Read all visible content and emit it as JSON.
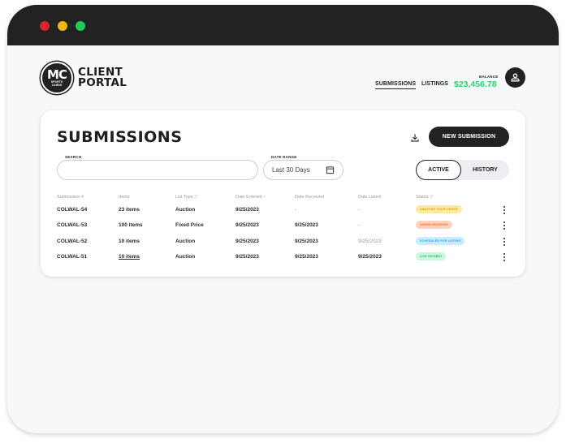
{
  "window": {
    "controls": [
      "close",
      "minimize",
      "maximize"
    ]
  },
  "brand": {
    "logo_initials": "MC",
    "logo_sub_1": "SPORTS",
    "logo_sub_2": "CARDS",
    "line1": "CLIENT",
    "line2": "PORTAL"
  },
  "nav": {
    "submissions": "SUBMISSIONS",
    "listings": "LISTINGS",
    "active": "SUBMISSIONS"
  },
  "balance": {
    "label": "BALANCE",
    "value": "$23,456.78",
    "color": "#2bd46a"
  },
  "page": {
    "title": "SUBMISSIONS",
    "new_submission_label": "NEW SUBMISSION",
    "search_label": "SEARCH",
    "search_value": "",
    "search_placeholder": "",
    "date_range_label": "DATE RANGE",
    "date_range_value": "Last 30 Days",
    "toggle": {
      "active": "ACTIVE",
      "history": "HISTORY",
      "selected": "ACTIVE"
    }
  },
  "table": {
    "columns": [
      "Submission #",
      "Items",
      "List Type",
      "Date Entered",
      "Date Received",
      "Date Listed",
      "Status"
    ],
    "rows": [
      {
        "id": "COLWAL-54",
        "items": "23 items",
        "list_type": "Auction",
        "date_entered": "9/25/2023",
        "date_received": "-",
        "date_listed": "-",
        "status": "AWAITING YOUR ORDER",
        "status_bg": "#fde9a6",
        "status_fg": "#d9a50b"
      },
      {
        "id": "COLWAL-53",
        "items": "100 items",
        "list_type": "Fixed Price",
        "date_entered": "9/25/2023",
        "date_received": "9/25/2023",
        "date_listed": "-",
        "status": "ORDER RECEIVED",
        "status_bg": "#fdd3bf",
        "status_fg": "#f06a26"
      },
      {
        "id": "COLWAL-52",
        "items": "10 items",
        "list_type": "Auction",
        "date_entered": "9/25/2023",
        "date_received": "9/25/2023",
        "date_listed": "9/25/2023",
        "status": "SCHEDULED FOR LISTING",
        "status_bg": "#c6ecfd",
        "status_fg": "#1fa8e6"
      },
      {
        "id": "COLWAL-51",
        "items": "10 items",
        "list_type": "Auction",
        "date_entered": "9/25/2023",
        "date_received": "9/25/2023",
        "date_listed": "9/25/2023",
        "status": "LIVE ON EBAY",
        "status_bg": "#c8f7dc",
        "status_fg": "#1fb95e"
      }
    ]
  }
}
